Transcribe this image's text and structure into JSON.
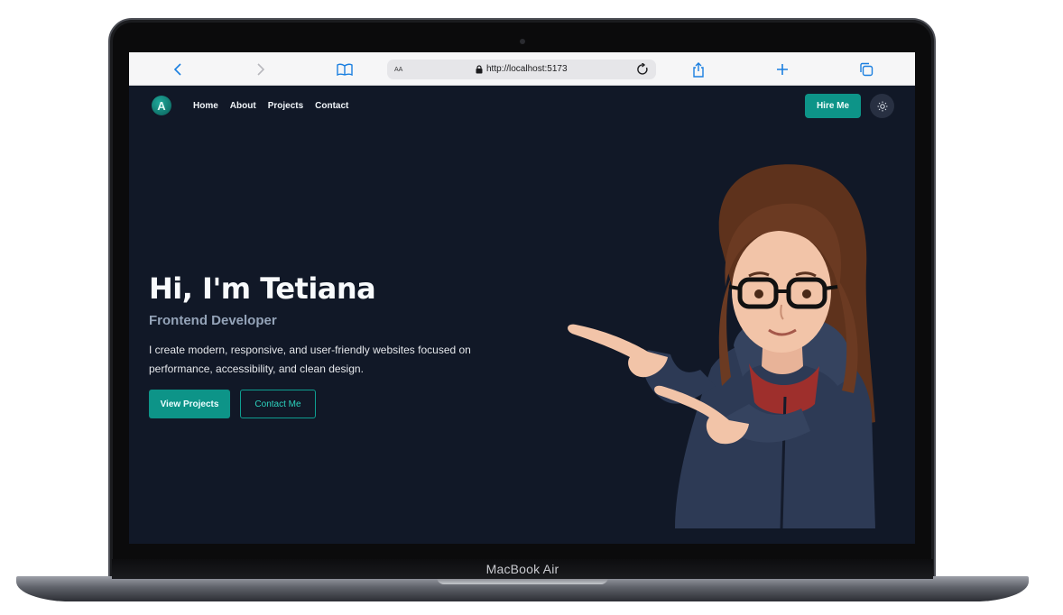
{
  "device": {
    "label": "MacBook Air"
  },
  "browser": {
    "text_size_label": "AA",
    "url": "http://localhost:5173",
    "icons": [
      "chevron-left-icon",
      "chevron-right-icon",
      "book-icon",
      "lock-icon",
      "reload-icon",
      "share-icon",
      "plus-icon",
      "tabs-icon"
    ]
  },
  "site": {
    "logo_letter": "A",
    "nav": {
      "items": [
        "Home",
        "About",
        "Projects",
        "Contact"
      ]
    },
    "hire_label": "Hire Me",
    "theme_icon": "sun-icon",
    "hero": {
      "title": "Hi, I'm Tetiana",
      "role": "Frontend Developer",
      "description": "I create modern, responsive, and user-friendly websites focused on performance, accessibility, and clean design.",
      "primary_button": "View Projects",
      "secondary_button": "Contact Me"
    }
  },
  "colors": {
    "page_bg": "#111827",
    "accent": "#0d9488",
    "hoodie": "#2d3a55",
    "hair": "#6b3a22"
  }
}
